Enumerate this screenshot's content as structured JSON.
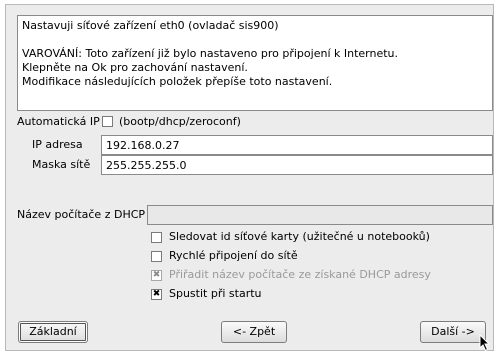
{
  "info": {
    "line1": "Nastavuji síťové zařízení eth0 (ovladač sis900)",
    "line2": "VAROVÁNÍ: Toto zařízení již bylo nastaveno pro připojení k Internetu.",
    "line3": "Klepněte na Ok pro zachování nastavení.",
    "line4": "Modifikace následujících položek přepíše toto nastavení."
  },
  "auto_ip": {
    "label": "Automatická IP",
    "checked": false,
    "hint": "(bootp/dhcp/zeroconf)"
  },
  "ip": {
    "label": "IP adresa",
    "value": "192.168.0.27"
  },
  "mask": {
    "label": "Maska sítě",
    "value": "255.255.255.0"
  },
  "dhcp": {
    "label": "Název počítače z DHCP",
    "value": ""
  },
  "options": {
    "track_id": {
      "label": "Sledovat id síťové karty (užitečné u notebooků)",
      "checked": false,
      "enabled": true
    },
    "fast_connect": {
      "label": "Rychlé připojení do sítě",
      "checked": false,
      "enabled": true
    },
    "assign_hostname": {
      "label": "Přiřadit název počítače ze získané DHCP adresy",
      "checked": true,
      "enabled": false
    },
    "start_on_boot": {
      "label": "Spustit při startu",
      "checked": true,
      "enabled": true
    }
  },
  "buttons": {
    "basic": "Základní",
    "back": "<- Zpět",
    "next": "Další ->"
  },
  "icons": {
    "checkmark": "✖",
    "cursor": "mouse-pointer-icon"
  }
}
